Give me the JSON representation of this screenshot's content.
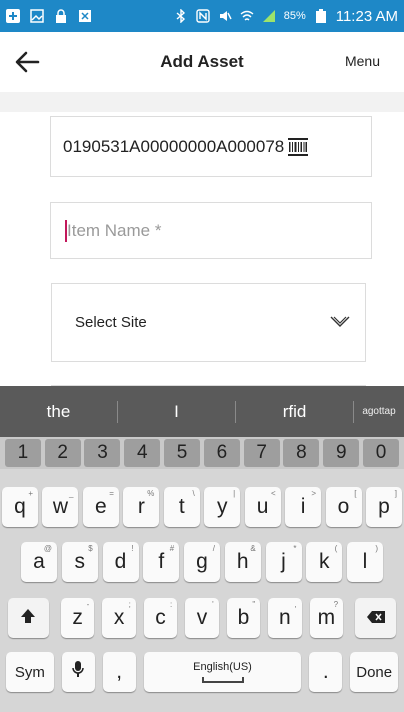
{
  "statusbar": {
    "battery_percent": "85%",
    "time": "11:23 AM"
  },
  "appbar": {
    "title": "Add Asset",
    "menu_label": "Menu"
  },
  "form": {
    "barcode_value": "0190531A00000000A000078",
    "item_name_placeholder": "Item Name *",
    "select_site_label": "Select Site"
  },
  "keyboard": {
    "suggestions": [
      "the",
      "I",
      "rfid",
      "agottap"
    ],
    "numbers": [
      "1",
      "2",
      "3",
      "4",
      "5",
      "6",
      "7",
      "8",
      "9",
      "0"
    ],
    "row1": [
      {
        "k": "q",
        "h": "+"
      },
      {
        "k": "w",
        "h": "_"
      },
      {
        "k": "e",
        "h": "="
      },
      {
        "k": "r",
        "h": "%"
      },
      {
        "k": "t",
        "h": "\\"
      },
      {
        "k": "y",
        "h": "|"
      },
      {
        "k": "u",
        "h": "<"
      },
      {
        "k": "i",
        "h": ">"
      },
      {
        "k": "o",
        "h": "["
      },
      {
        "k": "p",
        "h": "]"
      }
    ],
    "row2": [
      {
        "k": "a",
        "h": "@"
      },
      {
        "k": "s",
        "h": "$"
      },
      {
        "k": "d",
        "h": "!"
      },
      {
        "k": "f",
        "h": "#"
      },
      {
        "k": "g",
        "h": "/"
      },
      {
        "k": "h",
        "h": "&"
      },
      {
        "k": "j",
        "h": "*"
      },
      {
        "k": "k",
        "h": "("
      },
      {
        "k": "l",
        "h": ")"
      }
    ],
    "row3": [
      {
        "k": "z",
        "h": "-"
      },
      {
        "k": "x",
        "h": ";"
      },
      {
        "k": "c",
        "h": ":"
      },
      {
        "k": "v",
        "h": "'"
      },
      {
        "k": "b",
        "h": "\""
      },
      {
        "k": "n",
        "h": ","
      },
      {
        "k": "m",
        "h": "?"
      }
    ],
    "sym_label": "Sym",
    "comma_label": ",",
    "space_label": "English(US)",
    "period_label": ".",
    "done_label": "Done"
  },
  "colors": {
    "statusbar": "#1e88c7",
    "caret": "#c2185b",
    "suggestion_bar": "#5a5a5a"
  }
}
